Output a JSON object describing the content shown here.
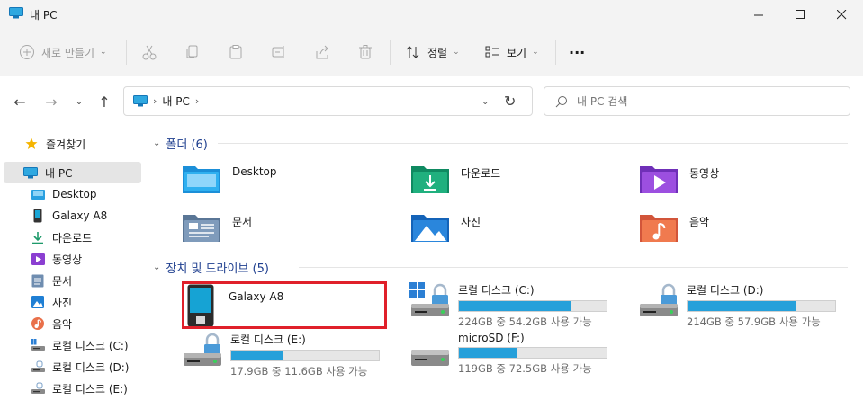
{
  "window": {
    "title": "내 PC"
  },
  "toolbar": {
    "new_label": "새로 만들기",
    "sort_label": "정렬",
    "view_label": "보기",
    "more_label": "···"
  },
  "address": {
    "crumbs": [
      "내 PC"
    ],
    "search_placeholder": "내 PC 검색"
  },
  "sidebar": {
    "items": [
      {
        "label": "즐겨찾기",
        "icon": "star-icon"
      },
      {
        "label": "내 PC",
        "icon": "pc-icon",
        "selected": true
      },
      {
        "label": "Desktop",
        "icon": "desktop-folder-icon"
      },
      {
        "label": "Galaxy A8",
        "icon": "phone-icon"
      },
      {
        "label": "다운로드",
        "icon": "download-icon"
      },
      {
        "label": "동영상",
        "icon": "video-icon"
      },
      {
        "label": "문서",
        "icon": "document-icon"
      },
      {
        "label": "사진",
        "icon": "picture-icon"
      },
      {
        "label": "음악",
        "icon": "music-icon"
      },
      {
        "label": "로컬 디스크 (C:)",
        "icon": "drive-icon"
      },
      {
        "label": "로컬 디스크 (D:)",
        "icon": "drive-icon"
      },
      {
        "label": "로컬 디스크 (E:)",
        "icon": "drive-icon"
      }
    ]
  },
  "folders": {
    "header": "폴더 (6)",
    "items": [
      {
        "label": "Desktop"
      },
      {
        "label": "다운로드"
      },
      {
        "label": "동영상"
      },
      {
        "label": "문서"
      },
      {
        "label": "사진"
      },
      {
        "label": "음악"
      }
    ]
  },
  "devices": {
    "header": "장치 및 드라이브 (5)",
    "phone": {
      "label": "Galaxy A8"
    },
    "drives": [
      {
        "name": "로컬 디스크 (C:)",
        "space": "224GB 중 54.2GB 사용 가능",
        "used_fraction": 0.76
      },
      {
        "name": "로컬 디스크 (D:)",
        "space": "214GB 중 57.9GB 사용 가능",
        "used_fraction": 0.73
      },
      {
        "name": "로컬 디스크 (E:)",
        "space": "17.9GB 중 11.6GB 사용 가능",
        "used_fraction": 0.35
      },
      {
        "name": "microSD (F:)",
        "space": "119GB 중 72.5GB 사용 가능",
        "used_fraction": 0.39
      }
    ]
  },
  "colors": {
    "accent": "#26a0da",
    "header": "#1f3f8f",
    "highlight": "#e0202a"
  }
}
